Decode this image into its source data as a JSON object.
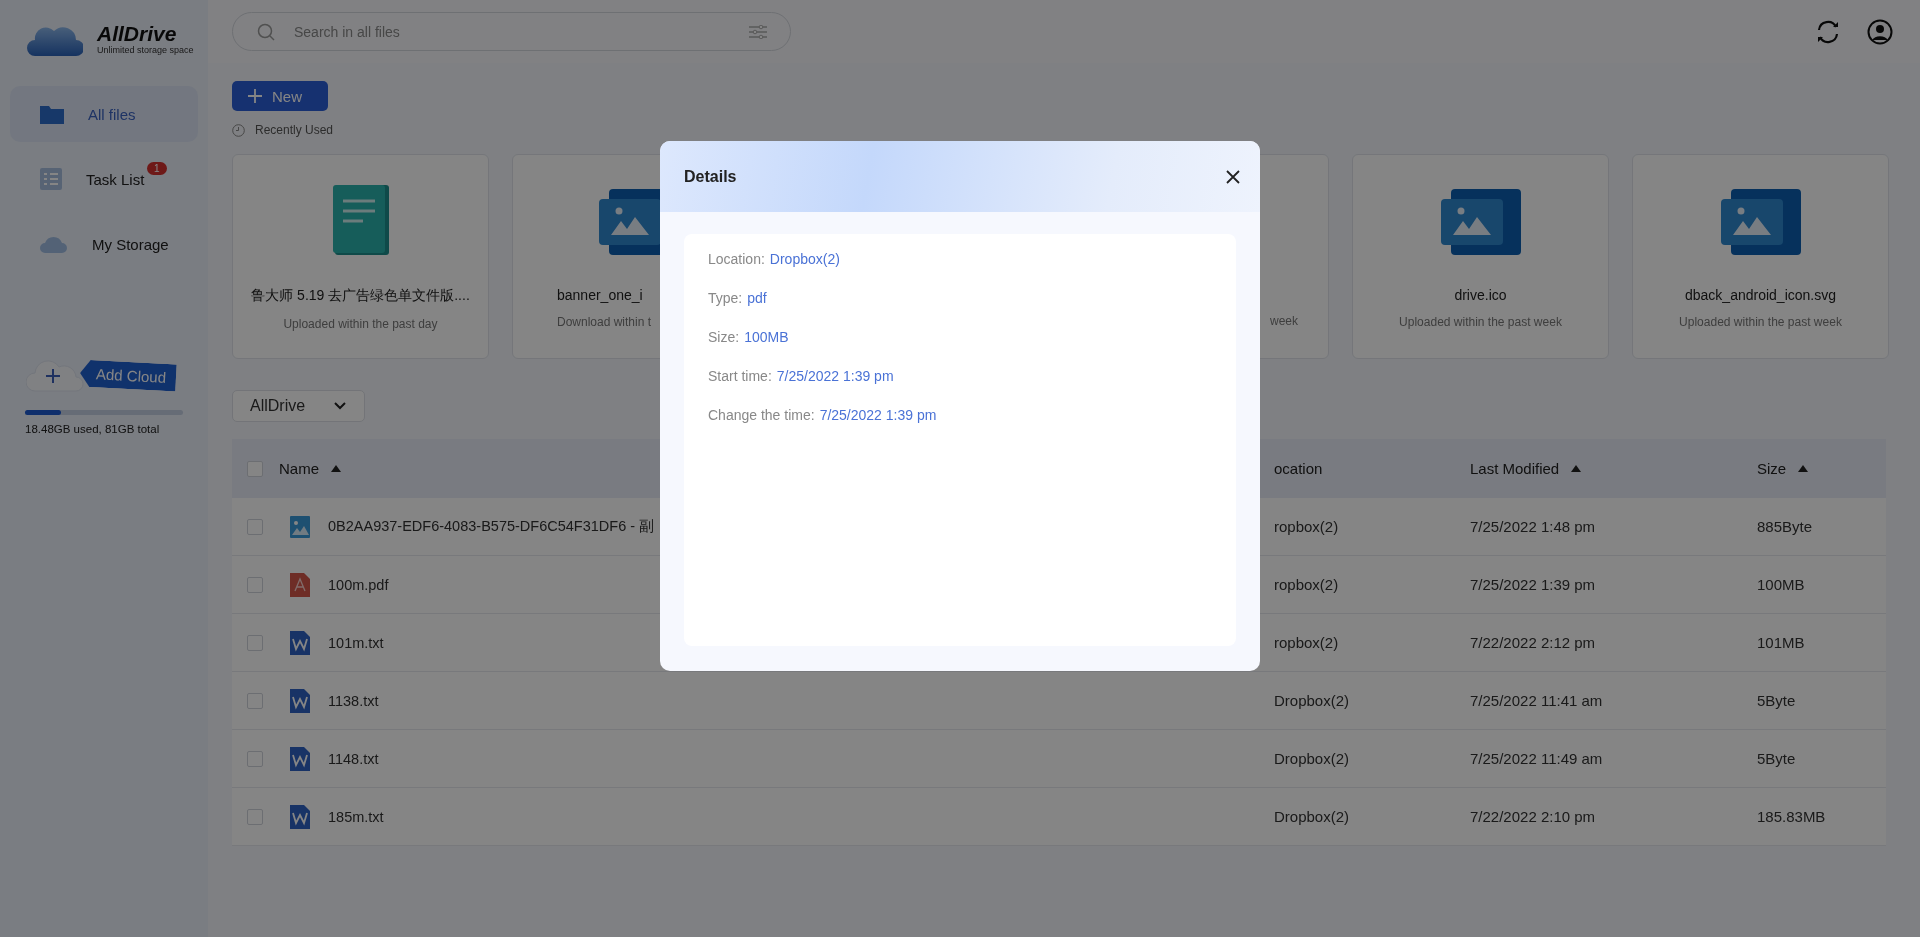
{
  "app": {
    "name": "AllDrive",
    "tagline": "Unlimited storage space"
  },
  "sidebar": {
    "items": [
      {
        "label": "All files",
        "selected": true,
        "kind": "folder"
      },
      {
        "label": "Task List",
        "selected": false,
        "kind": "tasks",
        "badge": "1"
      },
      {
        "label": "My Storage",
        "selected": false,
        "kind": "cloud"
      }
    ],
    "add_cloud": "Add Cloud",
    "storage": {
      "level": 0.23,
      "text": "18.48GB used, 81GB total"
    }
  },
  "search": {
    "placeholder": "Search in all files"
  },
  "new_button": "New",
  "recent": {
    "title": "Recently Used",
    "cards": [
      {
        "kind": "text",
        "name": "鲁大师 5.19 去广告绿色单文件版....",
        "note": "Uploaded within the past day"
      },
      {
        "kind": "image",
        "name": "banner_one_i",
        "note": "Download within t"
      },
      {
        "note": "week"
      },
      {
        "kind": "image",
        "name": "drive.ico",
        "note": "Uploaded within the past week"
      },
      {
        "kind": "image",
        "name": "dback_android_icon.svg",
        "note": "Uploaded within the past week"
      }
    ]
  },
  "source_dropdown": {
    "value": "AllDrive"
  },
  "table": {
    "all_checked": false,
    "columns": [
      {
        "label": "Name",
        "sortable": true
      },
      {
        "label": "ocation",
        "sortable": false
      },
      {
        "label": "Last Modified",
        "sortable": true
      },
      {
        "label": "Size",
        "sortable": true
      }
    ],
    "rows": [
      {
        "checked": false,
        "kind": "image",
        "name": "0B2AA937-EDF6-4083-B575-DF6C54F31DF6 - 副",
        "location": "ropbox(2)",
        "modified": "7/25/2022 1:48 pm",
        "size": "885Byte"
      },
      {
        "checked": false,
        "kind": "pdf",
        "name": "100m.pdf",
        "location": "ropbox(2)",
        "modified": "7/25/2022 1:39 pm",
        "size": "100MB"
      },
      {
        "checked": false,
        "kind": "doc",
        "name": "101m.txt",
        "location": "ropbox(2)",
        "modified": "7/22/2022 2:12 pm",
        "size": "101MB"
      },
      {
        "checked": false,
        "kind": "doc",
        "name": "1138.txt",
        "location": "Dropbox(2)",
        "modified": "7/25/2022 11:41 am",
        "size": "5Byte"
      },
      {
        "checked": false,
        "kind": "doc",
        "name": "1148.txt",
        "location": "Dropbox(2)",
        "modified": "7/25/2022 11:49 am",
        "size": "5Byte"
      },
      {
        "checked": false,
        "kind": "doc",
        "name": "185m.txt",
        "location": "Dropbox(2)",
        "modified": "7/22/2022 2:10 pm",
        "size": "185.83MB"
      }
    ]
  },
  "dialog": {
    "title": "Details",
    "fields": [
      {
        "label": "Location:",
        "value": "Dropbox(2)"
      },
      {
        "label": "Type:",
        "value": "pdf"
      },
      {
        "label": "Size:",
        "value": "100MB"
      },
      {
        "label": "Start time:",
        "value": "7/25/2022 1:39 pm"
      },
      {
        "label": "Change the time:",
        "value": "7/25/2022 1:39 pm"
      }
    ]
  }
}
